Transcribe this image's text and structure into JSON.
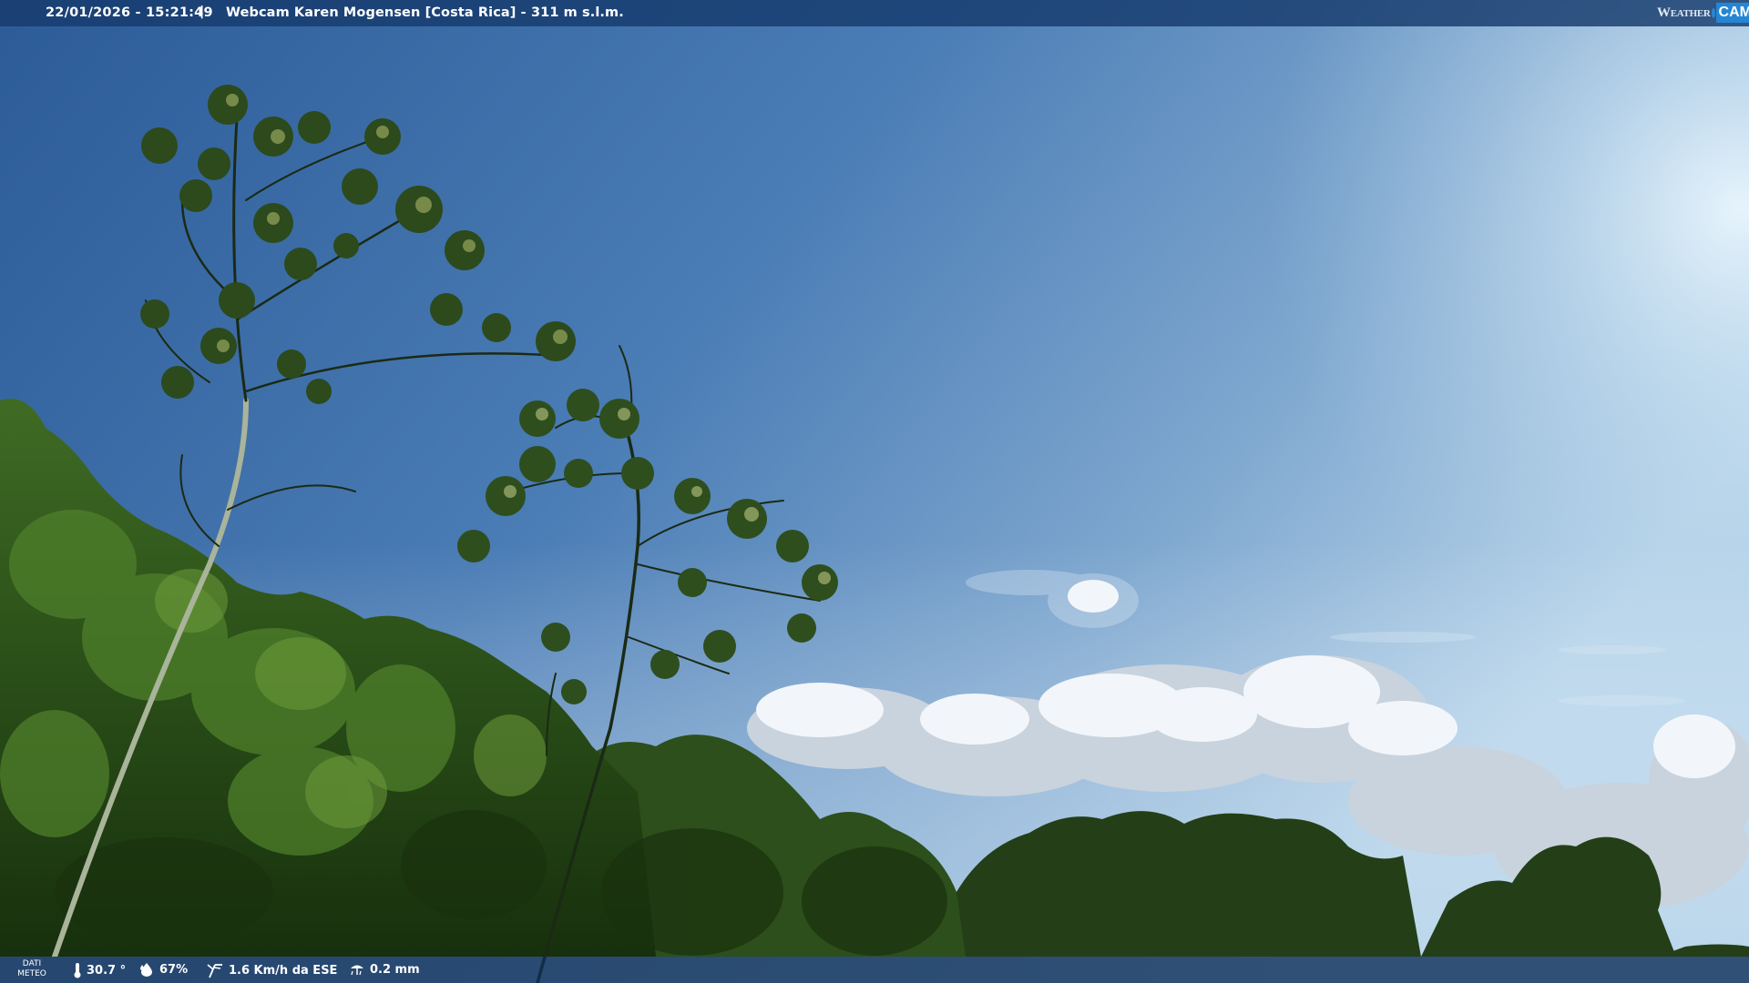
{
  "header": {
    "timestamp": "22/01/2026 - 15:21:49",
    "separator": "|",
    "camera_title": "Webcam Karen Mogensen [Costa Rica] - 311 m s.l.m.",
    "logo": {
      "word1": "Weather",
      "word2": "CAM"
    }
  },
  "footer": {
    "meteo_label_line1": "DATI",
    "meteo_label_line2": "METEO",
    "temperature": "30.7 °",
    "humidity": "67%",
    "wind": "1.6 Km/h da ESE",
    "rain": "0.2 mm",
    "icons": {
      "temperature": "thermometer-icon",
      "humidity": "humidity-drop-icon",
      "wind": "wind-icon",
      "rain": "rain-icon"
    }
  },
  "colors": {
    "sky_top": "#2f5f99",
    "sky_bright": "#cfe6f7",
    "foliage": "#1f3d14",
    "bar": "#163a6c"
  }
}
